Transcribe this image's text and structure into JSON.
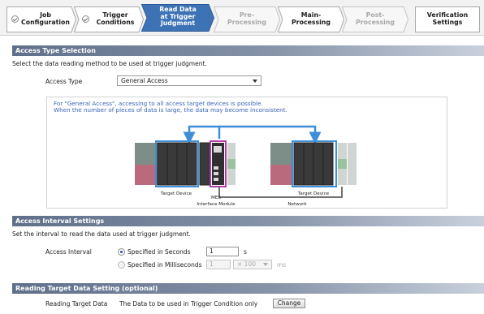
{
  "steps": [
    {
      "label": "Job\nConfiguration",
      "state": "done"
    },
    {
      "label": "Trigger\nConditions",
      "state": "done"
    },
    {
      "label": "Read Data\nat Trigger\nJudgment",
      "state": "active"
    },
    {
      "label": "Pre-\nProcessing",
      "state": "future"
    },
    {
      "label": "Main-\nProcessing",
      "state": "normal"
    },
    {
      "label": "Post-\nProcessing",
      "state": "future"
    },
    {
      "label": "Verification\nSettings",
      "state": "normal"
    }
  ],
  "access_type": {
    "heading": "Access Type Selection",
    "instruction": "Select the data reading method to be used at trigger judgment.",
    "field_label": "Access Type",
    "selected": "General Access",
    "info_line1": "For \"General Access\", accessing to all access target devices is possible.",
    "info_line2": "When the number of pieces of data is large, the data may become inconsistent.",
    "diagram": {
      "target_device_left": "Target Device",
      "mes_line1": "MES",
      "mes_line2": "Interface Module",
      "network": "Network",
      "target_device_right": "Target Device"
    }
  },
  "interval": {
    "heading": "Access Interval Settings",
    "instruction": "Set the interval to read the data used at trigger judgment.",
    "field_label": "Access Interval",
    "option_seconds": "Specified in Seconds",
    "seconds_value": "1",
    "seconds_unit": "s",
    "option_ms": "Specified in Milliseconds",
    "ms_value": "1",
    "ms_multiplier": "× 100",
    "ms_unit": "ms",
    "selected": "seconds"
  },
  "reading": {
    "heading": "Reading Target Data Setting (optional)",
    "field_label": "Reading Target Data",
    "value": "The Data to be used in Trigger Condition only",
    "change_button": "Change"
  },
  "colors": {
    "active_step": "#3d73b5",
    "section_header": "#5f6f8a",
    "info_text": "#3b65b8",
    "highlight_blue": "#3e8ed8",
    "highlight_magenta": "#b43aa8"
  }
}
